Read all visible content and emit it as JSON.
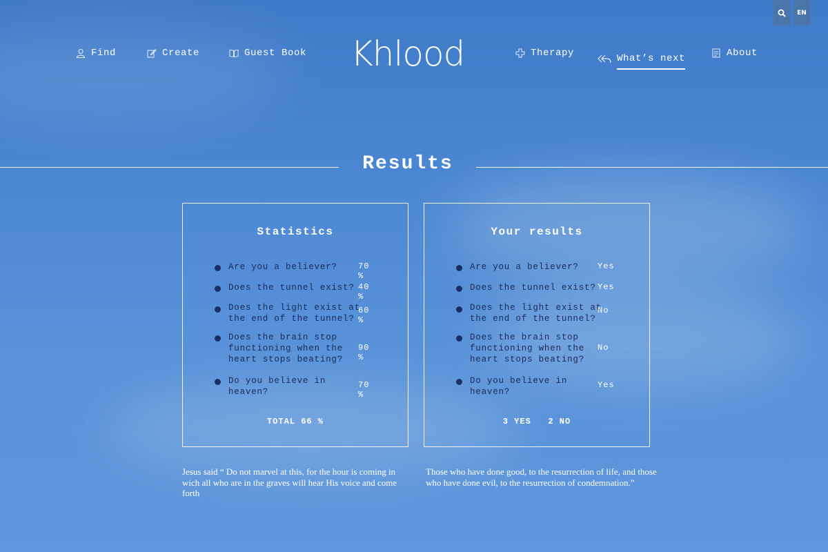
{
  "utilities": {
    "search_icon": "search-icon",
    "language": "EN"
  },
  "nav": {
    "left": [
      {
        "label": "Find",
        "icon": "user-icon"
      },
      {
        "label": "Create",
        "icon": "edit-icon"
      },
      {
        "label": "Guest Book",
        "icon": "book-icon"
      }
    ],
    "right": [
      {
        "label": "Therapy",
        "icon": "plus-icon"
      },
      {
        "label": "What’s next",
        "icon": "reply-all-icon",
        "active": true
      },
      {
        "label": "About",
        "icon": "document-icon"
      }
    ]
  },
  "logo": {
    "text": "Khlood"
  },
  "results": {
    "title": "Results"
  },
  "statistics": {
    "title": "Statistics",
    "rows": [
      {
        "question": "Are you a believer?",
        "value": "70 %"
      },
      {
        "question": "Does the tunnel exist?",
        "value": "40 %"
      },
      {
        "question": "Does the light exist at the end of the tunnel?",
        "value": "60 %"
      },
      {
        "question": "Does the brain stop functioning when the heart stops beating?",
        "value": "90 %"
      },
      {
        "question": "Do you believe in heaven?",
        "value": "70 %"
      }
    ],
    "total": "TOTAL 66 %"
  },
  "your_results": {
    "title": "Your results",
    "rows": [
      {
        "question": "Are you a believer?",
        "value": "Yes"
      },
      {
        "question": "Does the tunnel exist?",
        "value": "Yes"
      },
      {
        "question": "Does the light exist at the end of the tunnel?",
        "value": "No"
      },
      {
        "question": "Does the brain stop functioning when the heart stops beating?",
        "value": "No"
      },
      {
        "question": "Do you believe in heaven?",
        "value": "Yes"
      }
    ],
    "total": "3 YES   2 NO"
  },
  "quotes": {
    "left": "Jesus said “ Do not marvel at this, for the hour is coming in wich all who are in the graves will hear His voice and come forth",
    "right": "Those who have done good, to the resurrection of life, and those who have done evil, to the resurrection of condemnation.”"
  },
  "colors": {
    "sky_top": "#3f7ac8",
    "sky_bottom": "#5f97dc",
    "text_dark": "#1a2a58",
    "util_bg": "#4b74a8"
  }
}
